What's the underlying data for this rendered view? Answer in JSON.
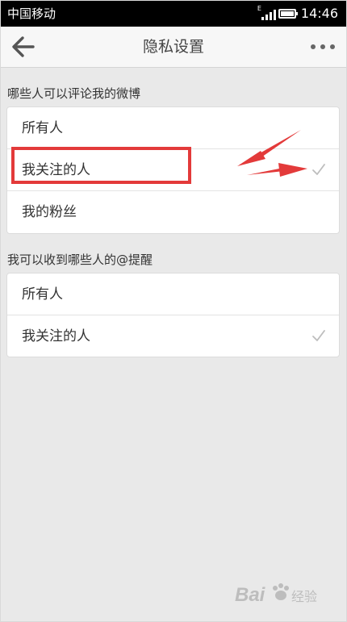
{
  "status_bar": {
    "carrier": "中国移动",
    "network_type": "E",
    "time": "14:46"
  },
  "header": {
    "title": "隐私设置",
    "back_icon": "arrow-left-icon",
    "more_icon": "more-dots-icon"
  },
  "sections": [
    {
      "title": "哪些人可以评论我的微博",
      "options": [
        {
          "label": "所有人",
          "selected": false
        },
        {
          "label": "我关注的人",
          "selected": true
        },
        {
          "label": "我的粉丝",
          "selected": false
        }
      ]
    },
    {
      "title": "我可以收到哪些人的@提醒",
      "options": [
        {
          "label": "所有人",
          "selected": false
        },
        {
          "label": "我关注的人",
          "selected": true
        }
      ]
    }
  ],
  "colors": {
    "annotation_red": "#e33a3a",
    "check_gray": "#bdbdbd"
  },
  "watermark": {
    "brand": "Bai",
    "suffix": "经验"
  }
}
